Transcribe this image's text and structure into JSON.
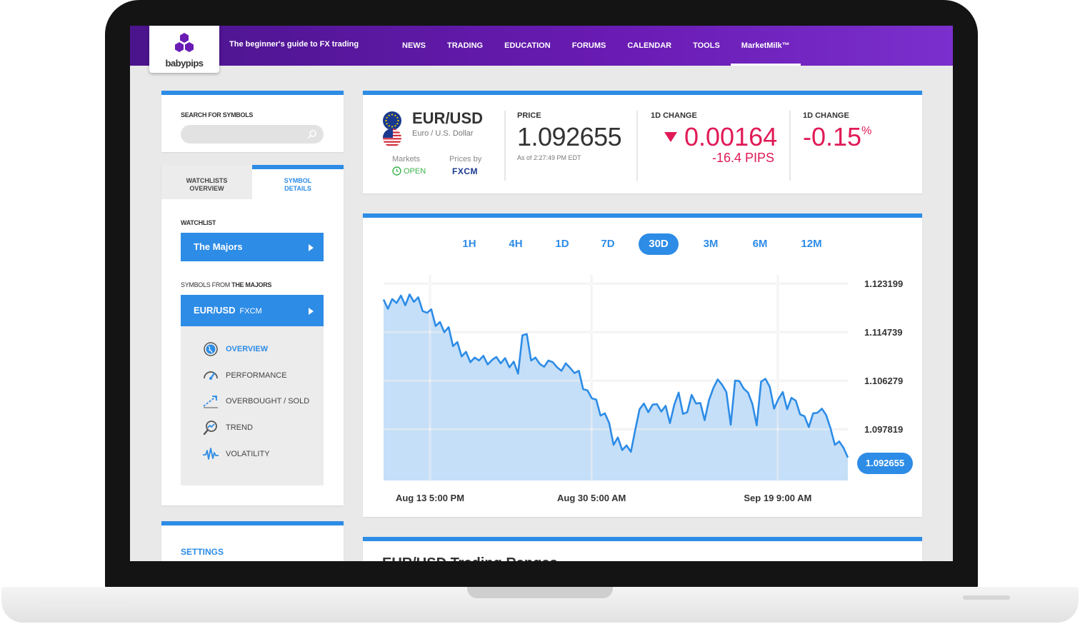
{
  "header": {
    "logo_text": "babypips",
    "tagline": "The beginner's guide to FX trading",
    "nav": [
      "NEWS",
      "TRADING",
      "EDUCATION",
      "FORUMS",
      "CALENDAR",
      "TOOLS",
      "MarketMilk™"
    ],
    "active_nav": "MarketMilk™",
    "brand_color": "#5a1aa6"
  },
  "sidebar": {
    "search_label": "SEARCH FOR SYMBOLS",
    "search_placeholder": "",
    "tabs": [
      "WATCHLISTS OVERVIEW",
      "SYMBOL DETAILS"
    ],
    "active_tab": "SYMBOL DETAILS",
    "watchlist_label": "WATCHLIST",
    "watchlist_value": "The Majors",
    "symbols_label": "SYMBOLS FROM",
    "symbols_label_bold": "THE MAJORS",
    "symbol": "EUR/USD",
    "symbol_source": "FXCM",
    "menu": [
      {
        "label": "OVERVIEW",
        "icon": "globe-icon"
      },
      {
        "label": "PERFORMANCE",
        "icon": "gauge-icon"
      },
      {
        "label": "OVERBOUGHT / SOLD",
        "icon": "trend-arrow-icon"
      },
      {
        "label": "TREND",
        "icon": "magnifier-trend-icon"
      },
      {
        "label": "VOLATILITY",
        "icon": "pulse-icon"
      }
    ],
    "settings_label": "SETTINGS"
  },
  "quote": {
    "pair": "EUR/USD",
    "pair_desc": "Euro / U.S. Dollar",
    "markets_label": "Markets",
    "markets_status": "OPEN",
    "prices_by_label": "Prices by",
    "provider": "FXCM",
    "price_label": "PRICE",
    "price": "1.092655",
    "as_of": "As of 2:27:49 PM EDT",
    "change_label": "1D CHANGE",
    "change": "0.00164",
    "change_pips": "-16.4 PIPS",
    "pct_label": "1D CHANGE",
    "pct": "-0.15",
    "pct_unit": "%",
    "negative_color": "#e01a56"
  },
  "chart_ranges": [
    "1H",
    "4H",
    "1D",
    "7D",
    "30D",
    "3M",
    "6M",
    "12M"
  ],
  "active_range": "30D",
  "chart_data": {
    "type": "area",
    "x_tick_labels": [
      "Aug 13 5:00 PM",
      "Aug 30 5:00 AM",
      "Sep 19 9:00 AM"
    ],
    "x_tick_positions": [
      0.1,
      0.448,
      0.849
    ],
    "y_tick_labels": [
      "1.123199",
      "1.114739",
      "1.106279",
      "1.097819"
    ],
    "ylim": [
      1.0889,
      1.1247
    ],
    "last_value": "1.092655",
    "series": [
      {
        "values": [
          1.1204,
          1.1188,
          1.1205,
          1.1198,
          1.1211,
          1.1194,
          1.1213,
          1.12,
          1.1208,
          1.1184,
          1.1181,
          1.1187,
          1.1158,
          1.1165,
          1.1147,
          1.1156,
          1.1123,
          1.113,
          1.1105,
          1.1113,
          1.1095,
          1.1103,
          1.1098,
          1.1106,
          1.1091,
          1.1099,
          1.1104,
          1.1093,
          1.1102,
          1.1086,
          1.1096,
          1.1075,
          1.1142,
          1.1144,
          1.1098,
          1.1103,
          1.1092,
          1.1087,
          1.1098,
          1.1095,
          1.1086,
          1.108,
          1.1093,
          1.1085,
          1.1076,
          1.108,
          1.1048,
          1.1046,
          1.1032,
          1.103,
          1.1002,
          1.1006,
          1.0989,
          1.0951,
          1.0964,
          1.0942,
          1.095,
          1.0939,
          1.0977,
          1.1013,
          1.1023,
          1.1008,
          1.1021,
          1.1022,
          1.1009,
          1.1019,
          1.0989,
          1.1021,
          1.1042,
          1.1005,
          1.1008,
          1.1038,
          1.1023,
          1.1024,
          1.0994,
          1.1029,
          1.105,
          1.1065,
          1.1056,
          1.1043,
          1.0986,
          1.1063,
          1.1062,
          1.1049,
          1.1042,
          1.1022,
          1.0985,
          1.1061,
          1.1066,
          1.1052,
          1.1014,
          1.1031,
          1.1043,
          1.1013,
          1.1033,
          1.1028,
          1.1004,
          1.1001,
          1.0982,
          1.1006,
          1.1007,
          1.1014,
          1.1003,
          1.098,
          1.0951,
          1.0957,
          1.0946,
          1.0929
        ]
      }
    ]
  },
  "bottom": {
    "title": "EUR/USD Trading Ranges"
  }
}
